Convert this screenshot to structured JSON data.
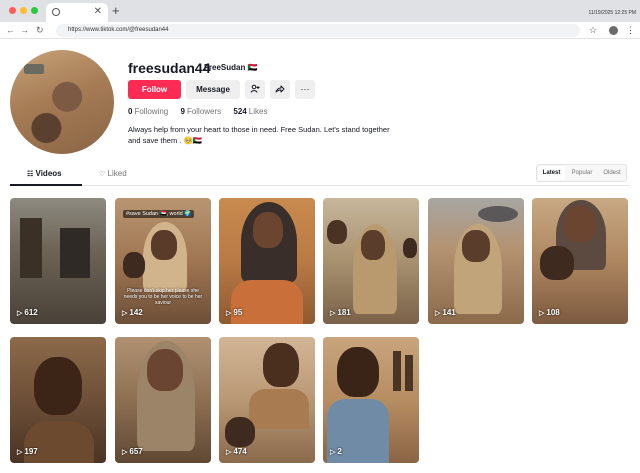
{
  "browser": {
    "clock": "11/19/2025 12:25 PM",
    "url": "https://www.tiktok.com/@freesudan44"
  },
  "profile": {
    "username": "freesudan44",
    "nickname": "FreeSudan 🇸🇩",
    "follow_label": "Follow",
    "message_label": "Message",
    "following_count": "0",
    "following_label": "Following",
    "followers_count": "9",
    "followers_label": "Followers",
    "likes_count": "524",
    "likes_label": "Likes",
    "bio_line1": "Always help from your heart to those in need. Free Sudan. Let's stand together",
    "bio_line2": "and save them . 🥺🇸🇩"
  },
  "tabs": {
    "videos": "Videos",
    "liked": "Liked"
  },
  "sort": {
    "latest": "Latest",
    "popular": "Popular",
    "oldest": "Oldest"
  },
  "videos": [
    {
      "plays": "612",
      "caption": "",
      "overlay": ""
    },
    {
      "plays": "142",
      "caption": "#save Sudan 🇸🇩, world 🌍",
      "overlay": "Please don't skip her please she needs you to be her voice to be her saviour"
    },
    {
      "plays": "95",
      "caption": "",
      "overlay": ""
    },
    {
      "plays": "181",
      "caption": "",
      "overlay": ""
    },
    {
      "plays": "141",
      "caption": "",
      "overlay": ""
    },
    {
      "plays": "108",
      "caption": "",
      "overlay": ""
    },
    {
      "plays": "197",
      "caption": "",
      "overlay": ""
    },
    {
      "plays": "657",
      "caption": "",
      "overlay": ""
    },
    {
      "plays": "474",
      "caption": "",
      "overlay": ""
    },
    {
      "plays": "2",
      "caption": "",
      "overlay": ""
    }
  ],
  "icons": {
    "add_friend": "person-plus-icon",
    "share": "share-icon",
    "more": "more-icon",
    "grid": "grid-icon",
    "heart": "heart-outline-icon",
    "play": "play-icon"
  },
  "colors": {
    "follow_button": "#fe2c55",
    "text": "#161823",
    "muted": "#757575"
  }
}
